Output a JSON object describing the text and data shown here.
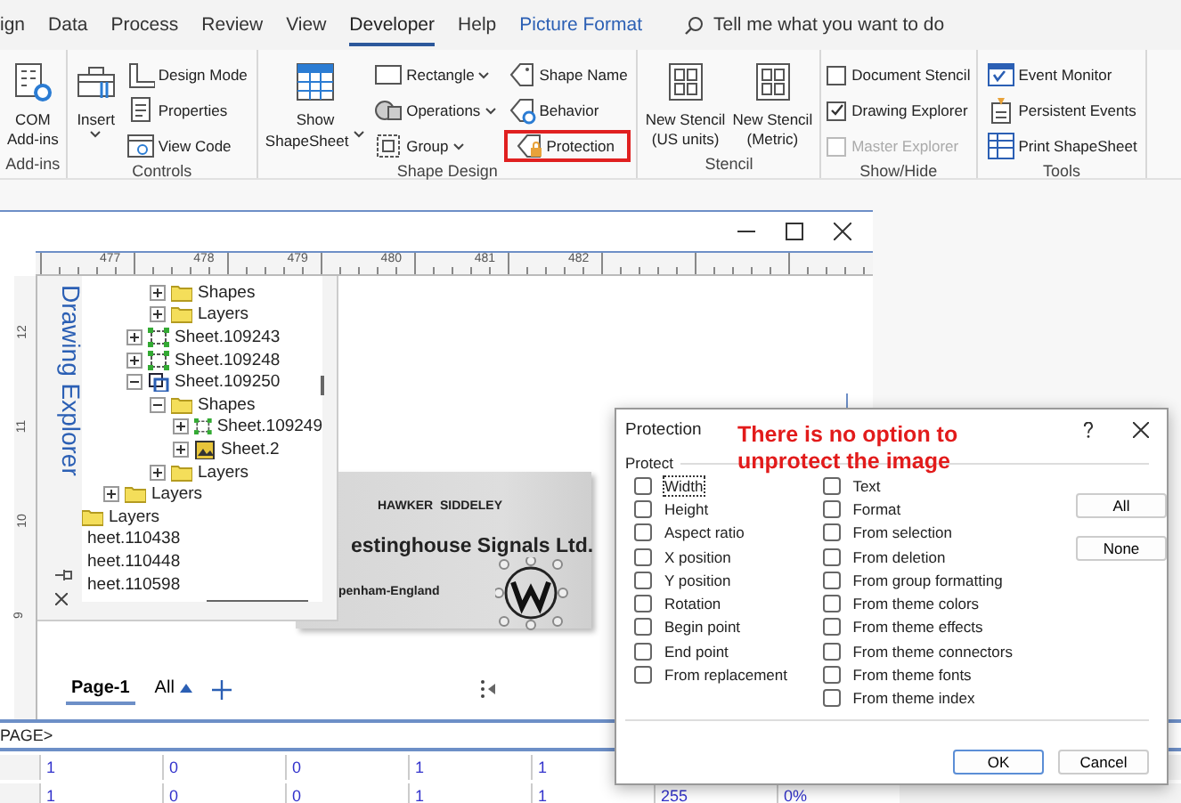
{
  "menu_tabs": [
    {
      "label": "ign",
      "selected": false,
      "contextual": false
    },
    {
      "label": "Data",
      "selected": false,
      "contextual": false
    },
    {
      "label": "Process",
      "selected": false,
      "contextual": false
    },
    {
      "label": "Review",
      "selected": false,
      "contextual": false
    },
    {
      "label": "View",
      "selected": false,
      "contextual": false
    },
    {
      "label": "Developer",
      "selected": true,
      "contextual": false
    },
    {
      "label": "Help",
      "selected": false,
      "contextual": false
    },
    {
      "label": "Picture Format",
      "selected": false,
      "contextual": true
    }
  ],
  "search": {
    "placeholder": "Tell me what you want to do"
  },
  "ribbon_groups": [
    {
      "label": "Add-ins",
      "columns": [
        [
          {
            "kind": "large",
            "lines": [
              "COM",
              "Add-ins"
            ],
            "dropdown": false
          }
        ]
      ]
    },
    {
      "label": "Controls",
      "columns": [
        [
          {
            "kind": "large",
            "lines": [
              "Insert"
            ],
            "dropdown": true
          }
        ],
        [
          {
            "kind": "small",
            "label": "Design Mode",
            "dropdown": false
          },
          {
            "kind": "small",
            "label": "Properties",
            "dropdown": false
          },
          {
            "kind": "small",
            "label": "View Code",
            "dropdown": false
          }
        ]
      ]
    },
    {
      "label": "Shape Design",
      "columns": [
        [
          {
            "kind": "large",
            "lines": [
              "Show",
              "ShapeSheet"
            ],
            "dropdown": true
          }
        ],
        [
          {
            "kind": "small",
            "label": "Rectangle",
            "dropdown": true
          },
          {
            "kind": "small",
            "label": "Operations",
            "dropdown": true
          },
          {
            "kind": "small",
            "label": "Group",
            "dropdown": true
          }
        ],
        [
          {
            "kind": "small",
            "label": "Shape Name",
            "dropdown": false,
            "highlighted": false
          },
          {
            "kind": "small",
            "label": "Behavior",
            "dropdown": false,
            "highlighted": false
          },
          {
            "kind": "small",
            "label": "Protection",
            "dropdown": false,
            "highlighted": true
          }
        ]
      ]
    },
    {
      "label": "Stencil",
      "columns": [
        [
          {
            "kind": "large",
            "lines": [
              "New Stencil",
              "(US units)"
            ],
            "dropdown": false
          }
        ],
        [
          {
            "kind": "large",
            "lines": [
              "New Stencil",
              "(Metric)"
            ],
            "dropdown": false
          }
        ]
      ]
    },
    {
      "label": "Show/Hide",
      "columns": [
        [
          {
            "kind": "check",
            "label": "Document Stencil",
            "checked": false,
            "disabled": false
          },
          {
            "kind": "check",
            "label": "Drawing Explorer",
            "checked": true,
            "disabled": false
          },
          {
            "kind": "check",
            "label": "Master Explorer",
            "checked": false,
            "disabled": true
          }
        ]
      ]
    },
    {
      "label": "Tools",
      "columns": [
        [
          {
            "kind": "small",
            "label": "Event Monitor",
            "dropdown": false
          },
          {
            "kind": "small",
            "label": "Persistent Events",
            "dropdown": false
          },
          {
            "kind": "small",
            "label": "Print ShapeSheet",
            "dropdown": false
          }
        ]
      ]
    }
  ],
  "drawing_window": {
    "ruler_marks": [
      "477",
      "478",
      "479",
      "480",
      "481",
      "482"
    ],
    "vertical_ruler_marks": [
      "12",
      "11",
      "10",
      "9"
    ],
    "explorer": {
      "title": "Drawing Explorer",
      "tree": [
        {
          "children": [
            {
              "children": [
                {
                  "children": [
                    {
                      "label": "Shapes",
                      "kind": "folder",
                      "expanded": false
                    },
                    {
                      "label": "Layers",
                      "kind": "folder",
                      "expanded": false
                    }
                  ]
                },
                {
                  "label": "Sheet.109243",
                  "kind": "shape",
                  "expanded": false
                },
                {
                  "label": "Sheet.109248",
                  "kind": "shape",
                  "expanded": false
                },
                {
                  "label": "Sheet.109250",
                  "kind": "group",
                  "expanded": true,
                  "children": [
                    {
                      "label": "Shapes",
                      "kind": "folder",
                      "expanded": true,
                      "children": [
                        {
                          "label": "Sheet.109249",
                          "kind": "shape",
                          "expanded": false
                        },
                        {
                          "label": "Sheet.2",
                          "kind": "image",
                          "expanded": false
                        }
                      ]
                    },
                    {
                      "label": "Layers",
                      "kind": "folder",
                      "expanded": false
                    }
                  ]
                }
              ]
            },
            {
              "label": "Layers",
              "kind": "folder",
              "expanded": false
            }
          ]
        },
        {
          "label": "Layers",
          "kind": "folder"
        },
        {
          "label": "heet.110438",
          "kind": "shape"
        },
        {
          "label": "heet.110448",
          "kind": "shape"
        },
        {
          "label": "heet.110598",
          "kind": "shape"
        }
      ]
    },
    "nameplate": {
      "maker": "HAWKER  SIDDELEY",
      "company": "estinghouse Signals Ltd.",
      "place": "penham-England"
    },
    "page_tabs": [
      {
        "label": "Page-1",
        "selected": true,
        "kind": "page"
      },
      {
        "label": "All",
        "selected": false,
        "kind": "menu"
      }
    ]
  },
  "shapesheet": {
    "formula": "PAGE>",
    "rows": [
      [
        "1",
        "0",
        "0",
        "1",
        "1"
      ],
      [
        "1",
        "0",
        "0",
        "1",
        "1",
        "255",
        "0%"
      ]
    ]
  },
  "dialog": {
    "title": "Protection",
    "annotation": [
      "There is no option to",
      "unprotect the image"
    ],
    "group_label": "Protect",
    "options_left": [
      {
        "label": "Width",
        "checked": false,
        "focused": true
      },
      {
        "label": "Height",
        "checked": false,
        "focused": false
      },
      {
        "label": "Aspect ratio",
        "checked": false,
        "focused": false
      },
      {
        "label": "X position",
        "checked": false,
        "focused": false
      },
      {
        "label": "Y position",
        "checked": false,
        "focused": false
      },
      {
        "label": "Rotation",
        "checked": false,
        "focused": false
      },
      {
        "label": "Begin point",
        "checked": false,
        "focused": false
      },
      {
        "label": "End point",
        "checked": false,
        "focused": false
      },
      {
        "label": "From replacement",
        "checked": false,
        "focused": false
      }
    ],
    "options_right": [
      {
        "label": "Text",
        "checked": false,
        "focused": false
      },
      {
        "label": "Format",
        "checked": false,
        "focused": false
      },
      {
        "label": "From selection",
        "checked": false,
        "focused": false
      },
      {
        "label": "From deletion",
        "checked": false,
        "focused": false
      },
      {
        "label": "From group formatting",
        "checked": false,
        "focused": false
      },
      {
        "label": "From theme colors",
        "checked": false,
        "focused": false
      },
      {
        "label": "From theme effects",
        "checked": false,
        "focused": false
      },
      {
        "label": "From theme connectors",
        "checked": false,
        "focused": false
      },
      {
        "label": "From theme fonts",
        "checked": false,
        "focused": false
      },
      {
        "label": "From theme index",
        "checked": false,
        "focused": false
      }
    ],
    "side_buttons": [
      "All",
      "None"
    ],
    "buttons": [
      {
        "label": "OK",
        "kind": "primary"
      },
      {
        "label": "Cancel",
        "kind": "normal"
      }
    ]
  }
}
